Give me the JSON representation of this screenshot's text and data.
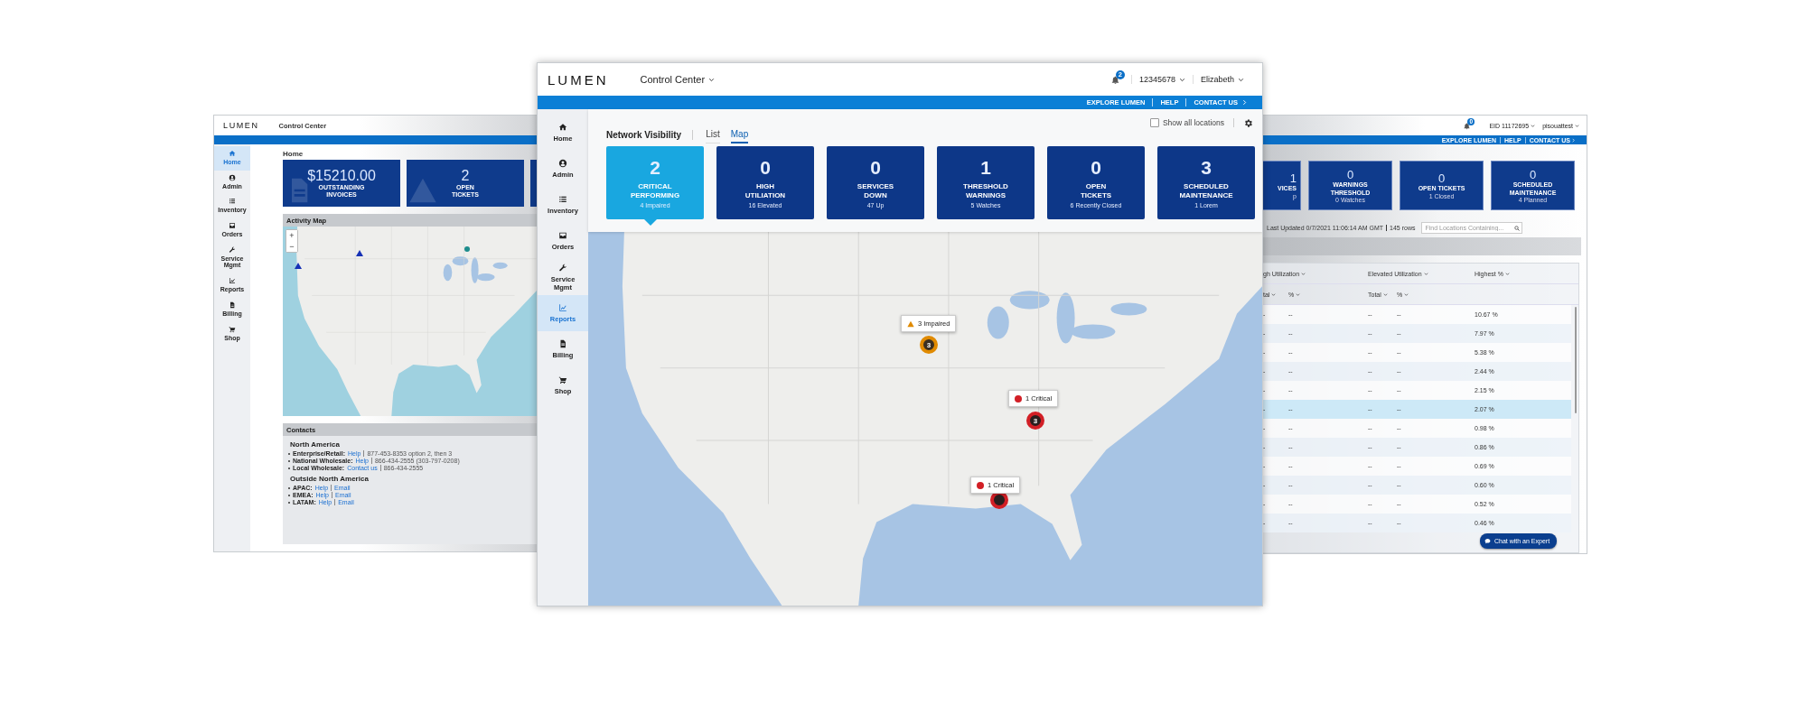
{
  "left_window": {
    "logo": "LUMEN",
    "app_title": "Control Center",
    "nav": [
      {
        "label": "Home",
        "selected": true
      },
      {
        "label": "Admin",
        "selected": false
      },
      {
        "label": "Inventory",
        "selected": false
      },
      {
        "label": "Orders",
        "selected": false
      },
      {
        "label": "Service Mgmt",
        "selected": false
      },
      {
        "label": "Reports",
        "selected": false
      },
      {
        "label": "Billing",
        "selected": false
      },
      {
        "label": "Shop",
        "selected": false
      }
    ],
    "page_title": "Home",
    "cards": [
      {
        "kind": "invoice",
        "value": "$15210.00",
        "label_lines": [
          "OUTSTANDING",
          "INVOICES"
        ]
      },
      {
        "kind": "tickets",
        "value": "2",
        "label_lines": [
          "OPEN",
          "TICKETS"
        ]
      },
      {
        "kind": "partial"
      }
    ],
    "activity_map": {
      "title": "Activity Map",
      "zoom_in": "+",
      "zoom_out": "−"
    },
    "contacts": {
      "title": "Contacts",
      "sections": [
        {
          "heading": "North America",
          "items": [
            {
              "label": "Enterprise/Retail:",
              "link": "Help",
              "info": "877-453-8353 option 2, then 3"
            },
            {
              "label": "National Wholesale:",
              "link": "Help",
              "info": "866-434-2555 (303-797-0208)"
            },
            {
              "label": "Local Wholesale:",
              "link": "Contact us",
              "info": "866-434-2555"
            }
          ]
        },
        {
          "heading": "Outside North America",
          "items": [
            {
              "label": "APAC:",
              "link": "Help",
              "link2": "Email"
            },
            {
              "label": "EMEA:",
              "link": "Help",
              "link2": "Email"
            },
            {
              "label": "LATAM:",
              "link": "Help",
              "link2": "Email"
            }
          ]
        }
      ]
    }
  },
  "center_window": {
    "logo": "LUMEN",
    "app_title": "Control Center",
    "notification_count": "2",
    "account": "12345678",
    "user": "Elizabeth",
    "top_links": [
      "EXPLORE LUMEN",
      "HELP",
      "CONTACT US"
    ],
    "nav": [
      {
        "label": "Home",
        "selected": false
      },
      {
        "label": "Admin",
        "selected": false
      },
      {
        "label": "Inventory",
        "selected": false
      },
      {
        "label": "Orders",
        "selected": false
      },
      {
        "label": "Service Mgmt",
        "selected": false
      },
      {
        "label": "Reports",
        "selected": true
      },
      {
        "label": "Billing",
        "selected": false
      },
      {
        "label": "Shop",
        "selected": false
      }
    ],
    "view_title": "Network Visibility",
    "tabs": [
      {
        "label": "List",
        "selected": false
      },
      {
        "label": "Map",
        "selected": true
      }
    ],
    "show_all_locations": {
      "label": "Show all locations",
      "checked": false
    },
    "cards": [
      {
        "value": "2",
        "label_lines": [
          "CRITICAL",
          "PERFORMING"
        ],
        "sub": "4 Impaired",
        "selected": true
      },
      {
        "value": "0",
        "label_lines": [
          "HIGH",
          "UTILIATION"
        ],
        "sub": "16 Elevated",
        "selected": false
      },
      {
        "value": "0",
        "label_lines": [
          "SERVICES",
          "DOWN"
        ],
        "sub": "47 Up",
        "selected": false
      },
      {
        "value": "1",
        "label_lines": [
          "THRESHOLD",
          "WARNINGS"
        ],
        "sub": "5 Watches",
        "selected": false
      },
      {
        "value": "0",
        "label_lines": [
          "OPEN",
          "TICKETS"
        ],
        "sub": "6 Recently Closed",
        "selected": false
      },
      {
        "value": "3",
        "label_lines": [
          "SCHEDULED",
          "MAINTENANCE"
        ],
        "sub": "1 Lorem",
        "selected": false
      }
    ],
    "map_markers": [
      {
        "kind": "warning",
        "label": "3 Impaired",
        "count": "3"
      },
      {
        "kind": "critical",
        "label": "1 Critical",
        "count": "3"
      },
      {
        "kind": "critical",
        "label": "1 Critical"
      }
    ]
  },
  "right_window": {
    "notification_count": "0",
    "account": "EID 11172695",
    "user": "pisouattest",
    "top_links": [
      "EXPLORE LUMEN",
      "HELP",
      "CONTACT US"
    ],
    "cards": [
      {
        "kind": "partial",
        "value": "1",
        "label_lines": [
          "VICES"
        ],
        "sub": "p"
      },
      {
        "kind": "full",
        "value": "0",
        "label_lines": [
          "WARNINGS",
          "THRESHOLD"
        ],
        "sub": "0 Watches"
      },
      {
        "kind": "full",
        "value": "0",
        "label_lines": [
          "OPEN TICKETS"
        ],
        "sub": "1 Closed"
      },
      {
        "kind": "full",
        "value": "0",
        "label_lines": [
          "SCHEDULED",
          "MAINTENANCE"
        ],
        "sub": "4 Planned"
      }
    ],
    "last_updated": "Last Updated 0/7/2021 11:06:14 AM GMT",
    "row_count": "145 rows",
    "search": {
      "placeholder": "Find Locations Containing..."
    },
    "table": {
      "groups": [
        "gh Utilization",
        "Elevated Utilization",
        "Highest %"
      ],
      "subcolumns": [
        "tal",
        "%",
        "Total",
        "%"
      ],
      "rows": [
        {
          "cells": [
            "-",
            "--",
            "--",
            "--",
            "10.67 %"
          ],
          "selected": false
        },
        {
          "cells": [
            "-",
            "--",
            "--",
            "--",
            "7.97 %"
          ],
          "selected": false
        },
        {
          "cells": [
            "-",
            "--",
            "--",
            "--",
            "5.38 %"
          ],
          "selected": false
        },
        {
          "cells": [
            "-",
            "--",
            "--",
            "--",
            "2.44 %"
          ],
          "selected": false
        },
        {
          "cells": [
            "-",
            "--",
            "--",
            "--",
            "2.15 %"
          ],
          "selected": false
        },
        {
          "cells": [
            "-",
            "--",
            "--",
            "--",
            "2.07 %"
          ],
          "selected": true
        },
        {
          "cells": [
            "-",
            "--",
            "--",
            "--",
            "0.98 %"
          ],
          "selected": false
        },
        {
          "cells": [
            "-",
            "--",
            "--",
            "--",
            "0.86 %"
          ],
          "selected": false
        },
        {
          "cells": [
            "-",
            "--",
            "--",
            "--",
            "0.69 %"
          ],
          "selected": false
        },
        {
          "cells": [
            "-",
            "--",
            "--",
            "--",
            "0.60 %"
          ],
          "selected": false
        },
        {
          "cells": [
            "-",
            "--",
            "--",
            "--",
            "0.52 %"
          ],
          "selected": false
        },
        {
          "cells": [
            "-",
            "--",
            "--",
            "--",
            "0.46 %"
          ],
          "selected": false
        }
      ]
    },
    "chat_button": "Chat with an Expert"
  }
}
